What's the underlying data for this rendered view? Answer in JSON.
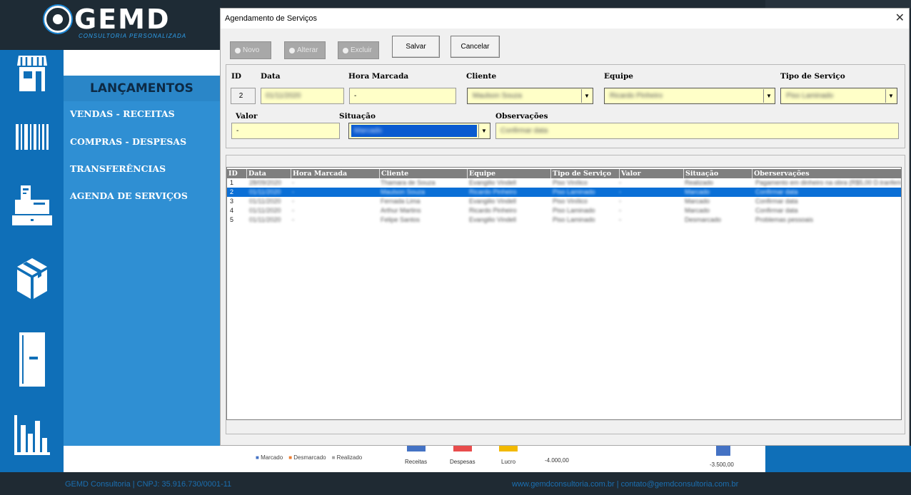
{
  "brand": {
    "logo_text": "GEMD",
    "logo_sub": "CONSULTORIA PERSONALIZADA"
  },
  "sidebar": {
    "icons": [
      "store-icon",
      "barcode-icon",
      "cash-register-icon",
      "box-icon",
      "door-icon",
      "bar-chart-icon"
    ],
    "section_title": "LANÇAMENTOS",
    "items": [
      {
        "label": "VENDAS - RECEITAS"
      },
      {
        "label": "COMPRAS - DESPESAS"
      },
      {
        "label": "TRANSFERÊNCIAS"
      },
      {
        "label": "AGENDA DE SERVIÇOS"
      }
    ]
  },
  "dialog": {
    "title": "Agendamento de Serviços",
    "close": "✕",
    "toolbar": {
      "novo": "Novo",
      "alterar": "Alterar",
      "excluir": "Excluir",
      "salvar": "Salvar",
      "cancelar": "Cancelar"
    },
    "form": {
      "labels": {
        "id": "ID",
        "data": "Data",
        "hora": "Hora Marcada",
        "cliente": "Cliente",
        "equipe": "Equipe",
        "tipo": "Tipo de Serviço",
        "valor": "Valor",
        "situacao": "Situação",
        "observacoes": "Observações"
      },
      "values": {
        "id": "2",
        "data": "01/11/2020",
        "hora": "-",
        "cliente": "Maulson Souza",
        "equipe": "Ricardo Pinheiro",
        "tipo": "Piso Laminado",
        "valor": "-",
        "situacao": "Marcado",
        "observacoes": "Confirmar data"
      }
    },
    "grid": {
      "columns": [
        "ID",
        "Data",
        "Hora Marcada",
        "Cliente",
        "Equipe",
        "Tipo de Serviço",
        "Valor",
        "Situação",
        "Oberservações"
      ],
      "rows": [
        [
          "1",
          "28/09/2020",
          "-",
          "Thamara de Souza",
          "Evangilio Vindell",
          "Piso Vinílico",
          "-",
          "Realizado",
          "Pagamento em dinheiro na obra (R$5,00 D.tranferido)"
        ],
        [
          "2",
          "01/11/2020",
          "-",
          "Maulson Souza",
          "Ricardo Pinheiro",
          "Piso Laminado",
          "-",
          "Marcado",
          "Confirmar data"
        ],
        [
          "3",
          "01/11/2020",
          "-",
          "Fernada Lima",
          "Evangilio Vindell",
          "Piso Vinílico",
          "-",
          "Marcado",
          "Confirmar data"
        ],
        [
          "4",
          "01/11/2020",
          "-",
          "Arthur Martins",
          "Ricardo Pinheiro",
          "Piso Laminado",
          "-",
          "Marcado",
          "Confirmar data"
        ],
        [
          "5",
          "01/11/2020",
          "-",
          "Felipe Santos",
          "Evangilio Vindell",
          "Piso Laminado",
          "-",
          "Desmarcado",
          "Problemas pessoais"
        ]
      ],
      "selected_row": 1
    }
  },
  "chart_strip": {
    "legend": [
      "Marcado",
      "Desmarcado",
      "Realizado"
    ],
    "categories": [
      "Receitas",
      "Despesas",
      "Lucro"
    ],
    "axis_value": "-4.000,00",
    "bar_label": "-3.500,00"
  },
  "colors": {
    "accent": "#0f6fb8",
    "field_bg": "#ffffc8",
    "selection": "#0a6fd6",
    "receitas": "#4472c4",
    "despesas": "#e84c4c",
    "lucro": "#f2b900"
  },
  "footer": {
    "left": "GEMD Consultoria  | CNPJ: 35.916.730/0001-11",
    "right": "www.gemdconsultoria.com.br | contato@gemdconsultoria.com.br"
  }
}
